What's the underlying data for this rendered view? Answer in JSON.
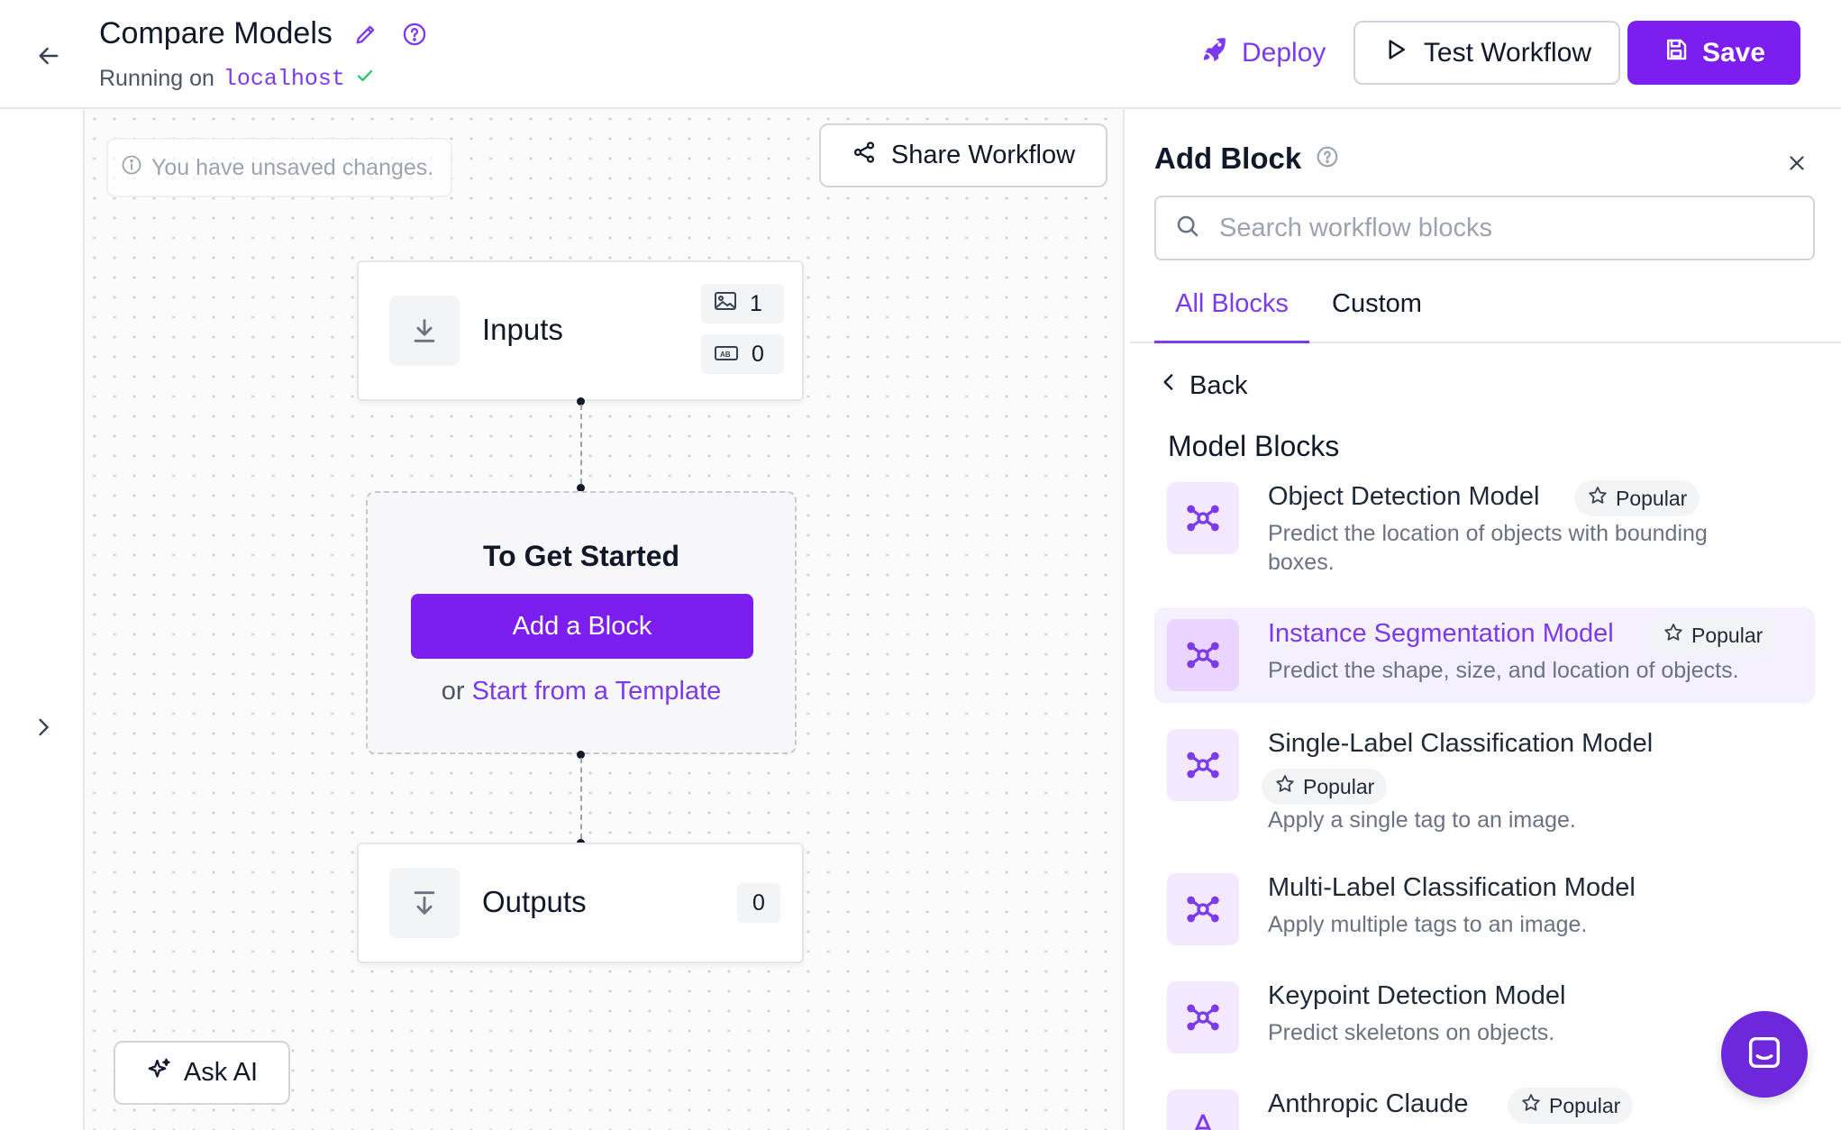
{
  "header": {
    "title": "Compare Models",
    "subtitle_prefix": "Running on",
    "host": "localhost",
    "deploy_label": "Deploy",
    "test_label": "Test Workflow",
    "save_label": "Save"
  },
  "canvas": {
    "unsaved_notice": "You have unsaved changes.",
    "share_label": "Share Workflow",
    "inputs_node": {
      "label": "Inputs",
      "image_count": "1",
      "text_count": "0"
    },
    "get_started": {
      "title": "To Get Started",
      "add_block_label": "Add a Block",
      "or_text": "or",
      "template_link": "Start from a Template"
    },
    "outputs_node": {
      "label": "Outputs",
      "count": "0"
    },
    "ask_ai_label": "Ask AI"
  },
  "panel": {
    "title": "Add Block",
    "search_placeholder": "Search workflow blocks",
    "tabs": [
      "All Blocks",
      "Custom"
    ],
    "back_label": "Back",
    "section_title": "Model Blocks",
    "popular_label": "Popular",
    "blocks": [
      {
        "name": "Object Detection Model",
        "desc": "Predict the location of objects with bounding boxes.",
        "popular": true
      },
      {
        "name": "Instance Segmentation Model",
        "desc": "Predict the shape, size, and location of objects.",
        "popular": true
      },
      {
        "name": "Single-Label Classification Model",
        "desc": "Apply a single tag to an image.",
        "popular": true
      },
      {
        "name": "Multi-Label Classification Model",
        "desc": "Apply multiple tags to an image.",
        "popular": false
      },
      {
        "name": "Keypoint Detection Model",
        "desc": "Predict skeletons on objects.",
        "popular": false
      },
      {
        "name": "Anthropic Claude",
        "desc": "",
        "popular": true
      }
    ]
  },
  "colors": {
    "accent": "#7c1ef0",
    "accent_text": "#7c3aed"
  }
}
